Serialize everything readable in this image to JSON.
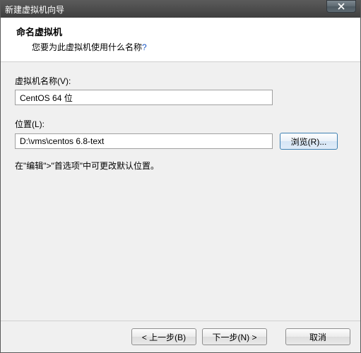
{
  "window": {
    "title": "新建虚拟机向导"
  },
  "header": {
    "title": "命名虚拟机",
    "subtitle_prefix": "您要为此虚拟机使用什么名称",
    "subtitle_q": "?"
  },
  "fields": {
    "name_label": "虚拟机名称(V):",
    "name_value": "CentOS 64 位",
    "location_label": "位置(L):",
    "location_value": "D:\\vms\\centos 6.8-text",
    "browse_label": "浏览(R)..."
  },
  "hint": "在\"编辑\">\"首选项\"中可更改默认位置。",
  "footer": {
    "back": "< 上一步(B)",
    "next": "下一步(N) >",
    "cancel": "取消"
  }
}
